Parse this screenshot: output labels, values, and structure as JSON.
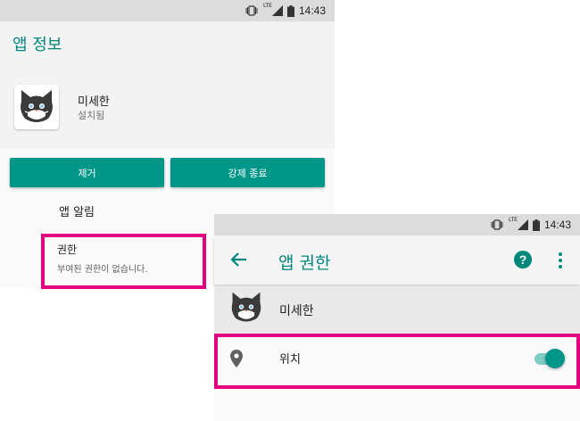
{
  "status_bar": {
    "network": "LTE",
    "time": "14:43"
  },
  "app_info": {
    "title": "앱 정보",
    "app_name": "미세한",
    "app_status": "설치됨",
    "uninstall_label": "제거",
    "force_stop_label": "강제 종료",
    "notifications_label": "앱 알림",
    "permissions": {
      "title": "권한",
      "description": "부여된 권한이 없습니다."
    }
  },
  "app_permissions": {
    "title": "앱 권한",
    "app_name": "미세한",
    "items": [
      {
        "label": "위치",
        "icon": "location-pin-icon",
        "enabled": true
      }
    ]
  },
  "colors": {
    "accent": "#009688",
    "title_teal": "#00897b",
    "highlight": "#e4007f"
  }
}
